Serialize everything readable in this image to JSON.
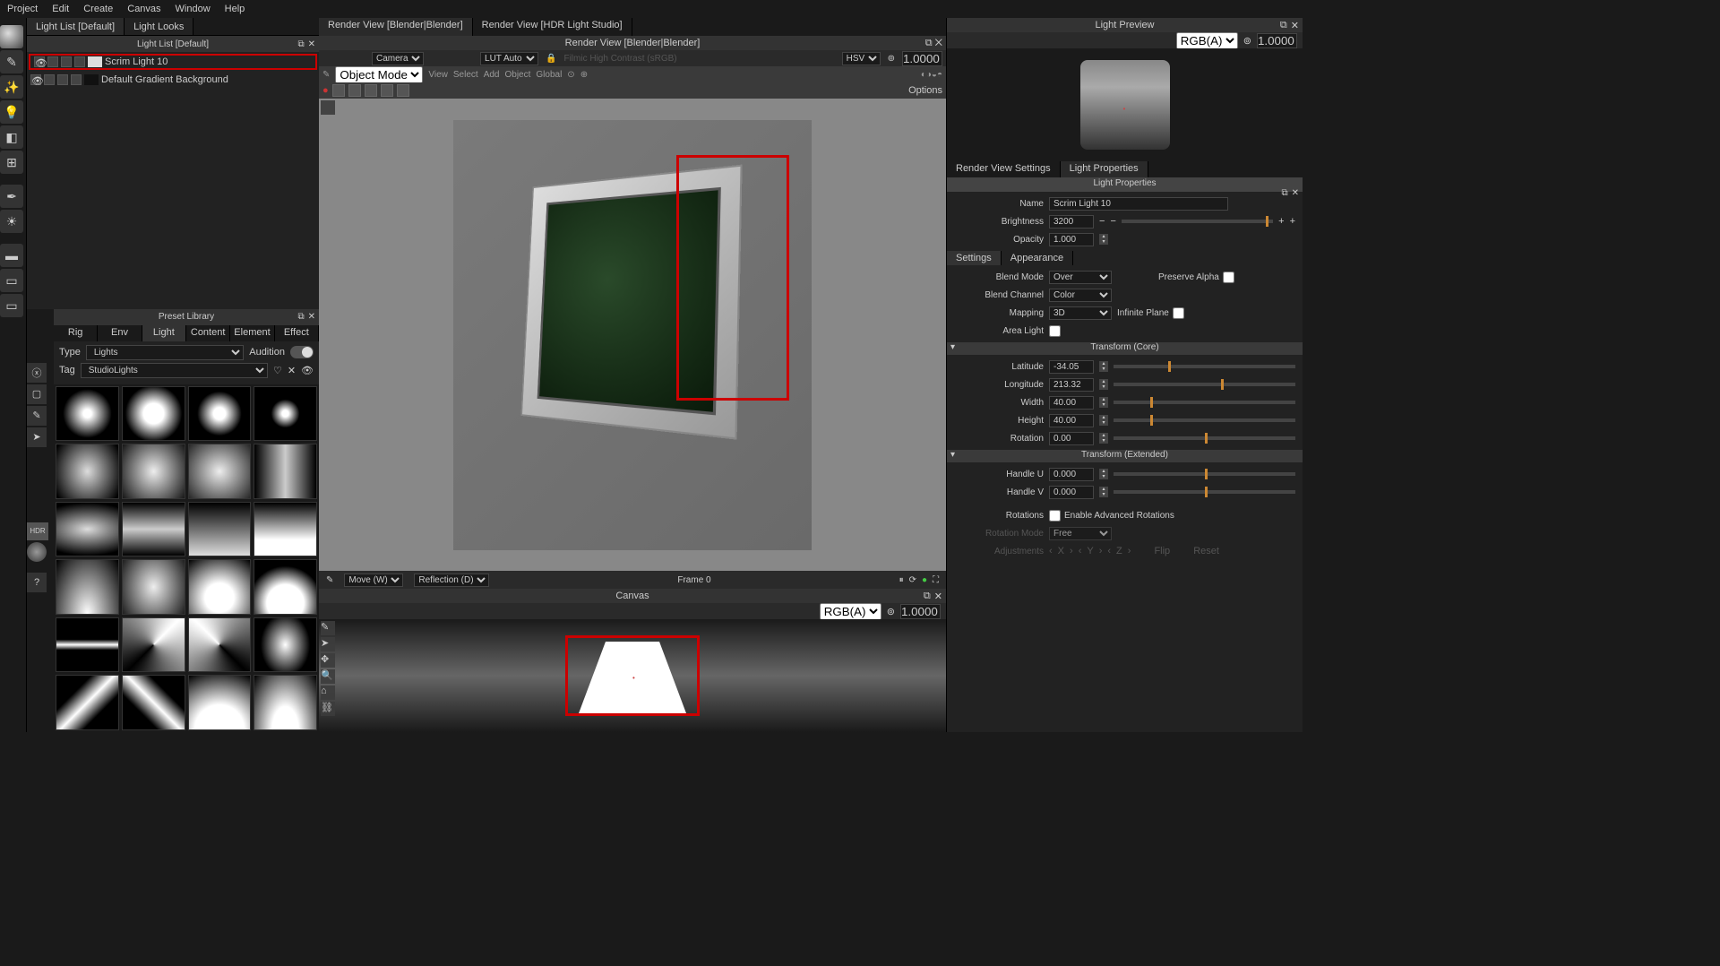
{
  "menu": [
    "Project",
    "Edit",
    "Create",
    "Canvas",
    "Window",
    "Help"
  ],
  "leftTabs": [
    "Light List [Default]",
    "Light Looks"
  ],
  "lightListTitle": "Light List [Default]",
  "lights": [
    {
      "name": "Scrim Light 10",
      "selected": true,
      "swatch": "light"
    },
    {
      "name": "Default Gradient Background",
      "selected": false,
      "swatch": "dark"
    }
  ],
  "presetLibrary": {
    "title": "Preset Library",
    "tabs": [
      "Rig",
      "Env",
      "Light",
      "Content",
      "Element",
      "Effect"
    ],
    "activeTab": "Light",
    "typeLabel": "Type",
    "typeValue": "Lights",
    "tagLabel": "Tag",
    "tagValue": "StudioLights",
    "auditionLabel": "Audition"
  },
  "renderTabs": [
    "Render View [Blender|Blender]",
    "Render View [HDR Light Studio]"
  ],
  "renderHeader": "Render View [Blender|Blender]",
  "renderBar1": {
    "camera": "Camera",
    "lut": "LUT Auto",
    "filmic": "Filmic High Contrast (sRGB)",
    "hsv": "HSV",
    "value": "1.0000"
  },
  "renderBar2": {
    "mode": "Object Mode",
    "items": [
      "View",
      "Select",
      "Add",
      "Object",
      "Global"
    ]
  },
  "renderBar3": {
    "options": "Options"
  },
  "renderFooter": {
    "move": "Move (W)",
    "reflection": "Reflection (D)",
    "frame": "Frame 0"
  },
  "canvas": {
    "title": "Canvas",
    "rgba": "RGB(A)",
    "value": "1.0000"
  },
  "lightPreview": {
    "title": "Light Preview",
    "rgba": "RGB(A)",
    "value": "1.0000"
  },
  "propsTabs": [
    "Render View Settings",
    "Light Properties"
  ],
  "propsActiveTab": "Light Properties",
  "propsTitle": "Light Properties",
  "props": {
    "nameLabel": "Name",
    "name": "Scrim Light 10",
    "brightnessLabel": "Brightness",
    "brightness": "3200",
    "opacityLabel": "Opacity",
    "opacity": "1.000",
    "settingsTabs": [
      "Settings",
      "Appearance"
    ],
    "blendModeLabel": "Blend Mode",
    "blendMode": "Over",
    "preserveAlphaLabel": "Preserve Alpha",
    "blendChannelLabel": "Blend Channel",
    "blendChannel": "Color",
    "mappingLabel": "Mapping",
    "mapping": "3D",
    "infinitePlaneLabel": "Infinite Plane",
    "areaLightLabel": "Area Light",
    "transformCoreTitle": "Transform (Core)",
    "latitudeLabel": "Latitude",
    "latitude": "-34.05",
    "longitudeLabel": "Longitude",
    "longitude": "213.32",
    "widthLabel": "Width",
    "width": "40.00",
    "heightLabel": "Height",
    "height": "40.00",
    "rotationLabel": "Rotation",
    "rotation": "0.00",
    "transformExtTitle": "Transform (Extended)",
    "handleULabel": "Handle U",
    "handleU": "0.000",
    "handleVLabel": "Handle V",
    "handleV": "0.000",
    "rotationsLabel": "Rotations",
    "enableAdvancedLabel": "Enable Advanced Rotations",
    "rotationModeLabel": "Rotation Mode",
    "rotationMode": "Free",
    "adjustmentsLabel": "Adjustments",
    "x": "X",
    "y": "Y",
    "z": "Z",
    "flip": "Flip",
    "reset": "Reset"
  }
}
